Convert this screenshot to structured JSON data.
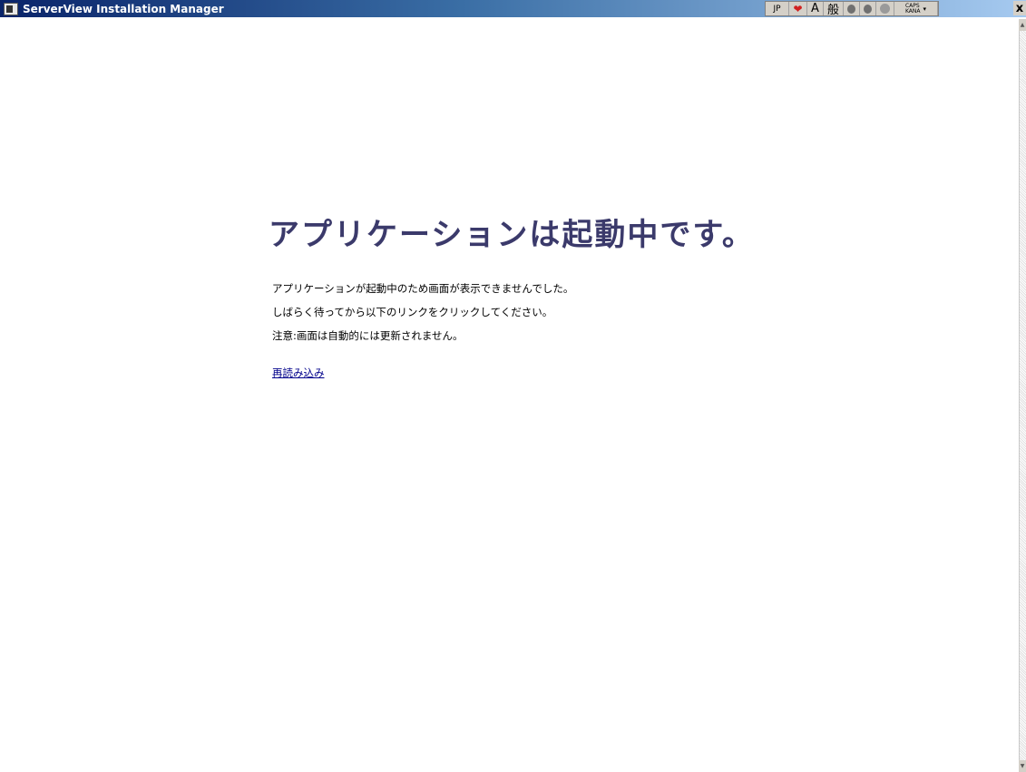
{
  "window": {
    "title": "ServerView Installation Manager",
    "close_label": "x"
  },
  "ime_bar": {
    "language": "JP",
    "input_mode": "A",
    "conversion_mode": "般",
    "caps_label": "CAPS",
    "kana_label": "KANA"
  },
  "main": {
    "heading": "アプリケーションは起動中です。",
    "messages": [
      "アプリケーションが起動中のため画面が表示できませんでした。",
      "しばらく待ってから以下のリンクをクリックしてください。",
      "注意:画面は自動的には更新されません。"
    ],
    "reload_link": "再読み込み"
  },
  "colors": {
    "heading": "#3b3a6b",
    "link": "#00008b",
    "titlebar_start": "#0a246a",
    "titlebar_end": "#a6caf0"
  }
}
